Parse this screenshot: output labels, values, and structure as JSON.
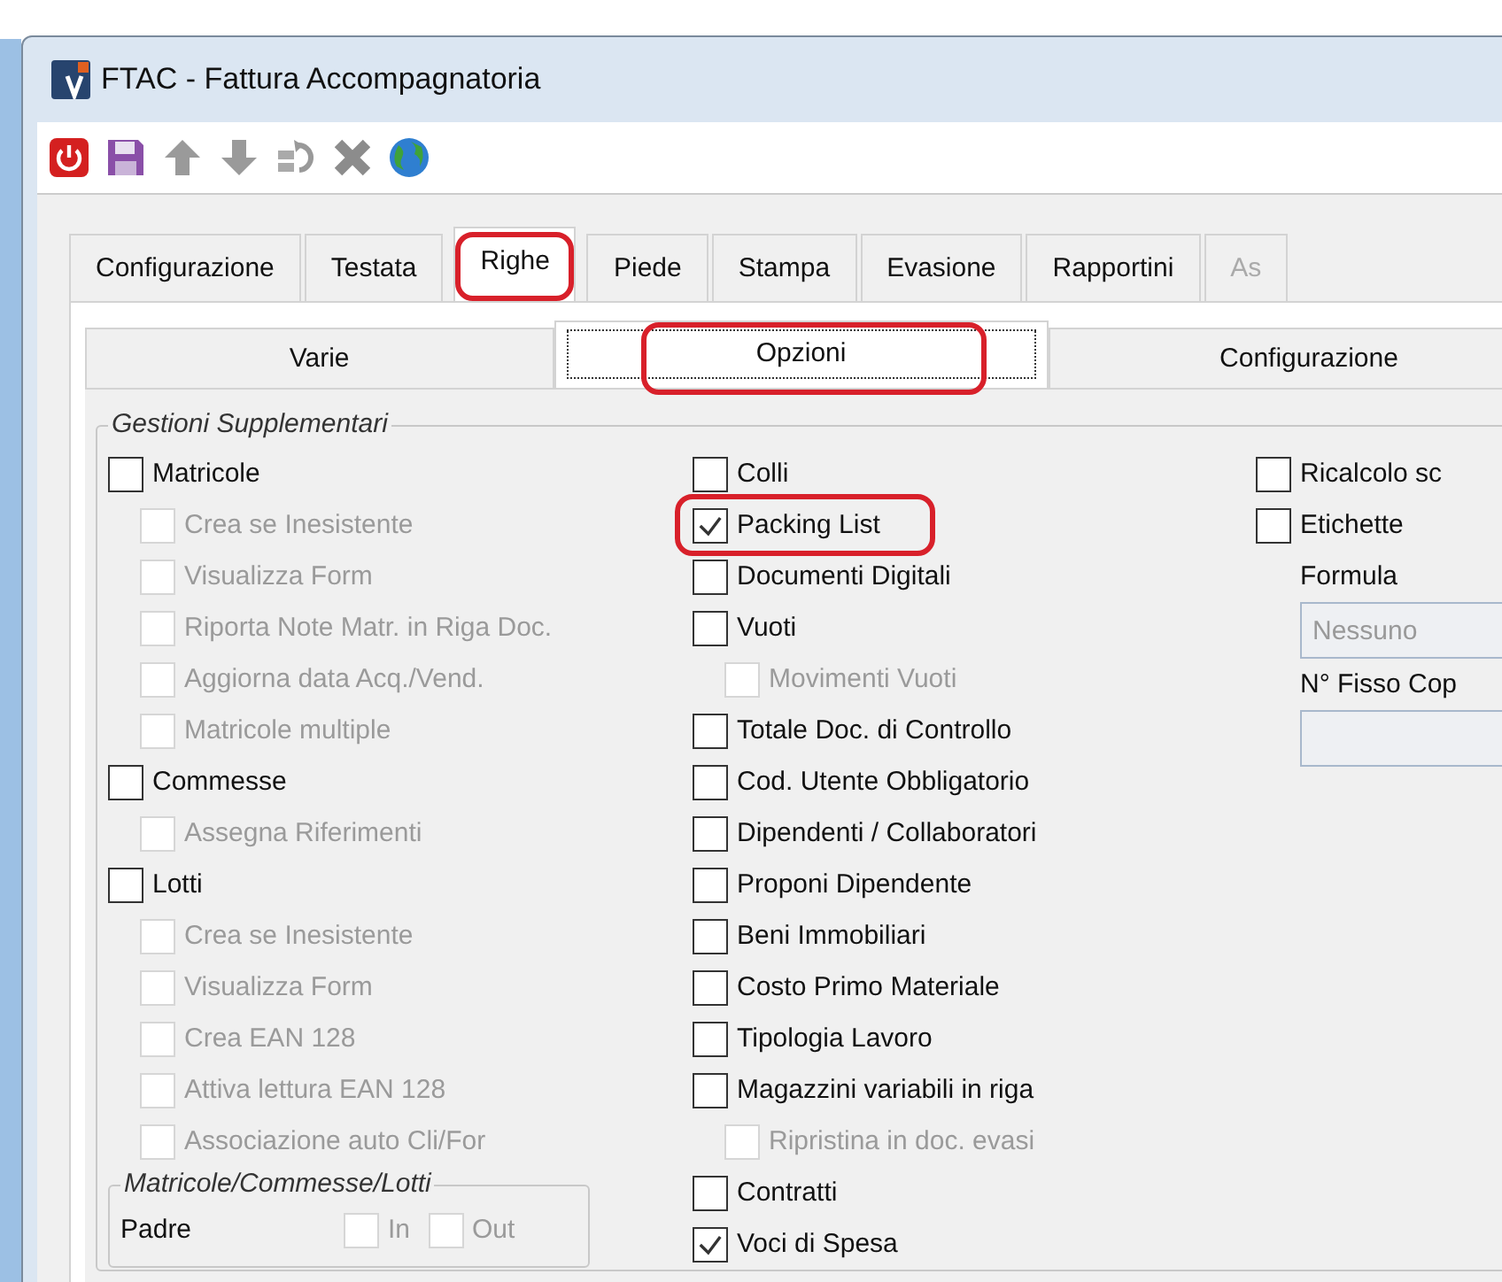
{
  "window": {
    "title": "FTAC - Fattura Accompagnatoria"
  },
  "toolbar": [
    {
      "kind": "power"
    },
    {
      "kind": "save"
    },
    {
      "kind": "up"
    },
    {
      "kind": "down"
    },
    {
      "kind": "swap"
    },
    {
      "kind": "delete"
    },
    {
      "kind": "globe"
    }
  ],
  "tabs": [
    {
      "label": "Configurazione",
      "selected": false,
      "highlighted": false,
      "disabled": false
    },
    {
      "label": "Testata",
      "selected": false,
      "highlighted": false,
      "disabled": false
    },
    {
      "label": "Righe",
      "selected": true,
      "highlighted": true,
      "disabled": false
    },
    {
      "label": "Piede",
      "selected": false,
      "highlighted": false,
      "disabled": false
    },
    {
      "label": "Stampa",
      "selected": false,
      "highlighted": false,
      "disabled": false
    },
    {
      "label": "Evasione",
      "selected": false,
      "highlighted": false,
      "disabled": false
    },
    {
      "label": "Rapportini",
      "selected": false,
      "highlighted": false,
      "disabled": false
    },
    {
      "label": "As",
      "selected": false,
      "highlighted": false,
      "disabled": true
    }
  ],
  "subtabs": [
    {
      "label": "Varie",
      "selected": false,
      "highlighted": false
    },
    {
      "label": "Opzioni",
      "selected": true,
      "highlighted": true
    },
    {
      "label": "Configurazione",
      "selected": false,
      "highlighted": false
    }
  ],
  "group": {
    "title": "Gestioni Supplementari",
    "column_1": [
      {
        "label": "Matricole",
        "checked": false,
        "disabled": false,
        "children": [
          {
            "label": "Crea se Inesistente",
            "checked": false,
            "disabled": true
          },
          {
            "label": "Visualizza Form",
            "checked": false,
            "disabled": true
          },
          {
            "label": "Riporta Note Matr. in Riga Doc.",
            "checked": false,
            "disabled": true
          },
          {
            "label": "Aggiorna data Acq./Vend.",
            "checked": false,
            "disabled": true
          },
          {
            "label": "Matricole multiple",
            "checked": false,
            "disabled": true
          }
        ]
      },
      {
        "label": "Commesse",
        "checked": false,
        "disabled": false,
        "children": [
          {
            "label": "Assegna Riferimenti",
            "checked": false,
            "disabled": true
          }
        ]
      },
      {
        "label": "Lotti",
        "checked": false,
        "disabled": false,
        "children": [
          {
            "label": "Crea se Inesistente",
            "checked": false,
            "disabled": true
          },
          {
            "label": "Visualizza Form",
            "checked": false,
            "disabled": true
          },
          {
            "label": "Crea EAN 128",
            "checked": false,
            "disabled": true
          },
          {
            "label": "Attiva lettura EAN 128",
            "checked": false,
            "disabled": true
          },
          {
            "label": "Associazione auto Cli/For",
            "checked": false,
            "disabled": true
          }
        ]
      }
    ],
    "subgroup": {
      "title": "Matricole/Commesse/Lotti",
      "label": "Padre",
      "options": [
        {
          "label": "In",
          "checked": false,
          "disabled": true
        },
        {
          "label": "Out",
          "checked": false,
          "disabled": true
        }
      ]
    },
    "column_2": [
      {
        "label": "Colli",
        "checked": false,
        "disabled": false,
        "highlighted": false
      },
      {
        "label": "Packing List",
        "checked": true,
        "disabled": false,
        "highlighted": true
      },
      {
        "label": "Documenti Digitali",
        "checked": false,
        "disabled": false,
        "highlighted": false
      },
      {
        "label": "Vuoti",
        "checked": false,
        "disabled": false,
        "highlighted": false,
        "children": [
          {
            "label": "Movimenti Vuoti",
            "checked": false,
            "disabled": true
          }
        ]
      },
      {
        "label": "Totale Doc. di Controllo",
        "checked": false,
        "disabled": false,
        "highlighted": false
      },
      {
        "label": "Cod. Utente Obbligatorio",
        "checked": false,
        "disabled": false,
        "highlighted": false
      },
      {
        "label": "Dipendenti / Collaboratori",
        "checked": false,
        "disabled": false,
        "highlighted": false
      },
      {
        "label": "Proponi Dipendente",
        "checked": false,
        "disabled": false,
        "highlighted": false
      },
      {
        "label": "Beni Immobiliari",
        "checked": false,
        "disabled": false,
        "highlighted": false
      },
      {
        "label": "Costo Primo Materiale",
        "checked": false,
        "disabled": false,
        "highlighted": false
      },
      {
        "label": "Tipologia Lavoro",
        "checked": false,
        "disabled": false,
        "highlighted": false
      },
      {
        "label": "Magazzini variabili in riga",
        "checked": false,
        "disabled": false,
        "highlighted": false,
        "children": [
          {
            "label": "Ripristina in doc. evasi",
            "checked": false,
            "disabled": true
          }
        ]
      },
      {
        "label": "Contratti",
        "checked": false,
        "disabled": false,
        "highlighted": false
      },
      {
        "label": "Voci di Spesa",
        "checked": true,
        "disabled": false,
        "highlighted": false
      }
    ],
    "column_3": [
      {
        "kind": "checkbox",
        "label": "Ricalcolo sc",
        "checked": false
      },
      {
        "kind": "checkbox",
        "label": "Etichette",
        "checked": false
      },
      {
        "kind": "label",
        "label": "Formula"
      },
      {
        "kind": "field",
        "value": "Nessuno"
      },
      {
        "kind": "label",
        "label": "N° Fisso Cop"
      },
      {
        "kind": "field"
      }
    ]
  }
}
